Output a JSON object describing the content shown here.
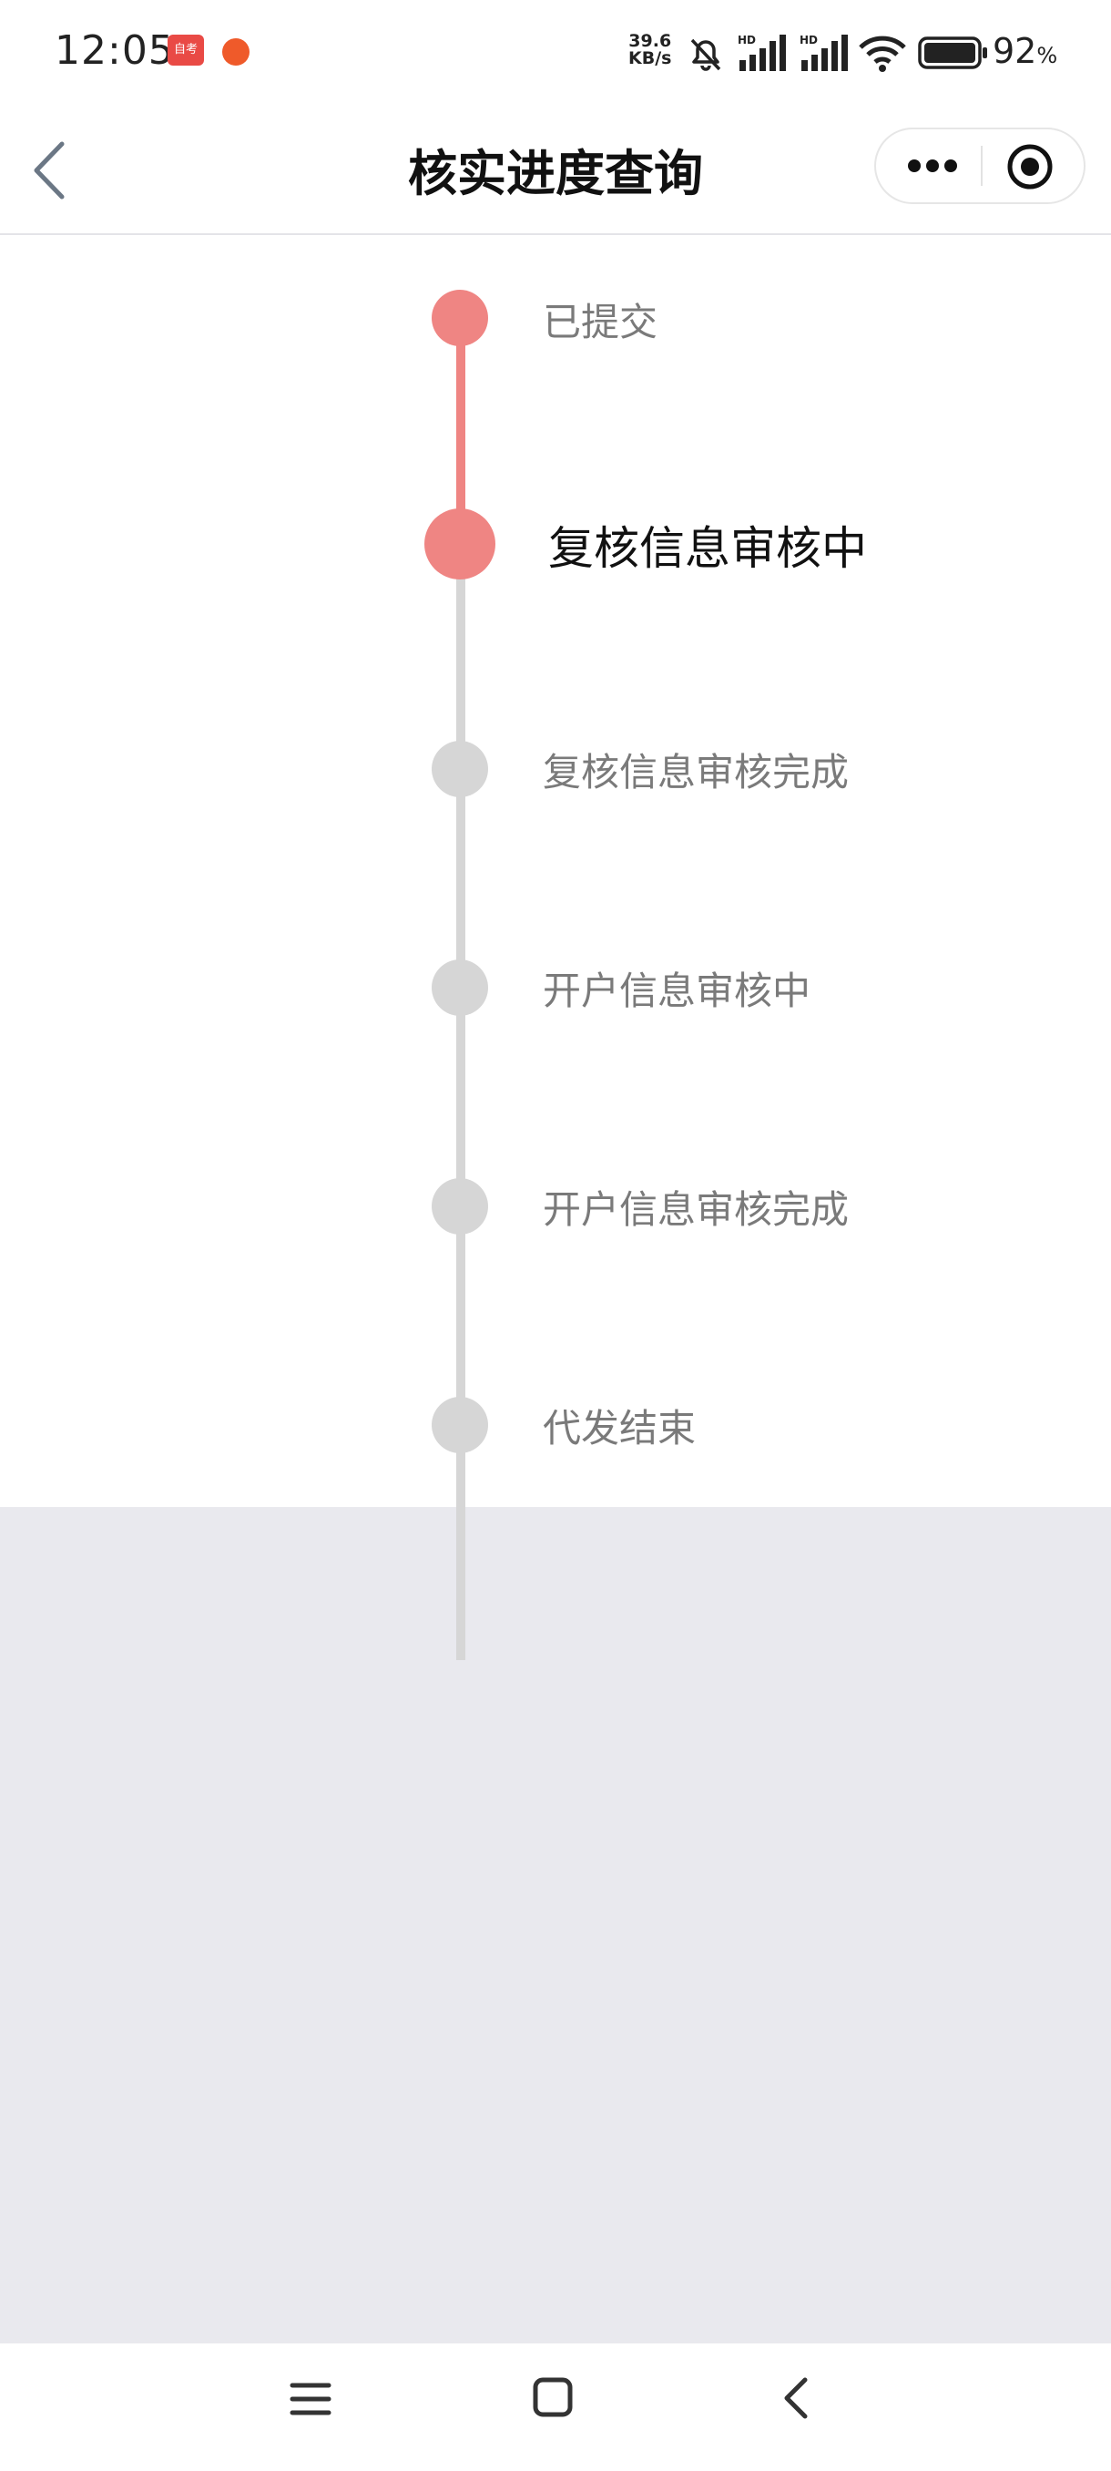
{
  "status_bar": {
    "time": "12:05",
    "app_badge_text": "自考",
    "net_speed_value": "39.6",
    "net_speed_unit": "KB/s",
    "signal1_label": "HD",
    "signal2_label": "HD",
    "battery_percent": "92",
    "battery_unit": "%"
  },
  "nav": {
    "title": "核实进度查询"
  },
  "timeline": {
    "steps": [
      {
        "label": "已提交",
        "status": "done"
      },
      {
        "label": "复核信息审核中",
        "status": "current"
      },
      {
        "label": "复核信息审核完成",
        "status": "pending"
      },
      {
        "label": "开户信息审核中",
        "status": "pending"
      },
      {
        "label": "开户信息审核完成",
        "status": "pending"
      },
      {
        "label": "代发结束",
        "status": "pending"
      }
    ]
  },
  "colors": {
    "done": "#ef8583",
    "pending": "#d6d6d6",
    "background": "#e9e9ee"
  },
  "icons": {
    "back": "chevron-left-icon",
    "more": "more-dots-icon",
    "close": "target-close-icon",
    "menu": "menu-lines-icon",
    "home": "home-square-icon",
    "system_back": "chevron-left-icon"
  }
}
